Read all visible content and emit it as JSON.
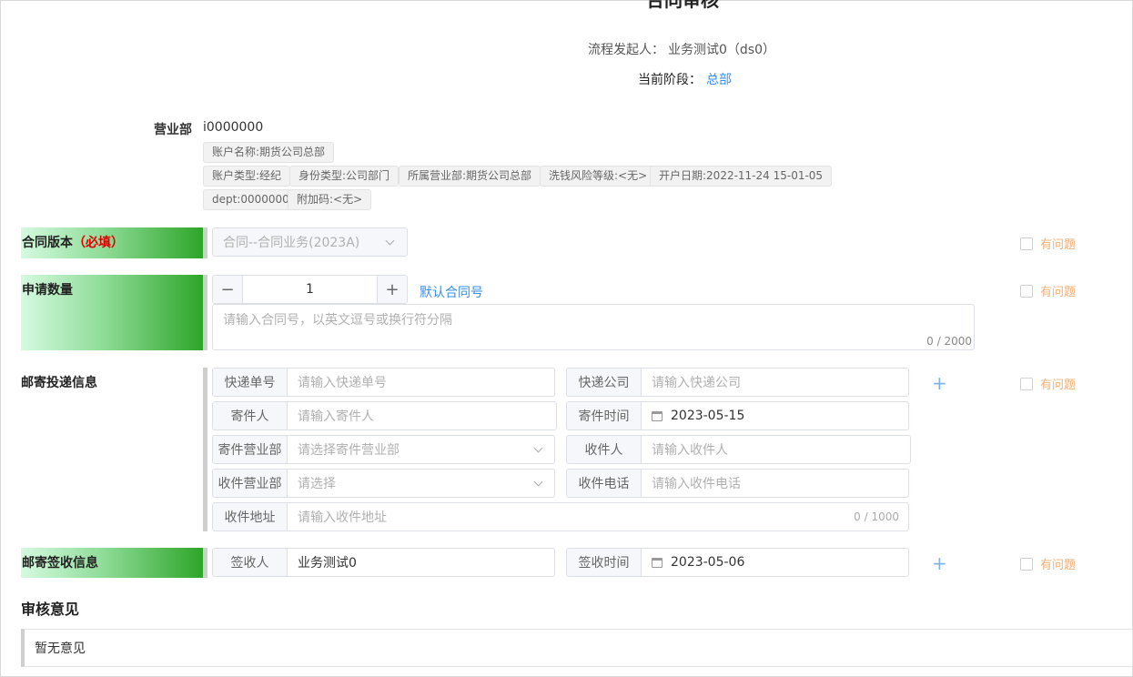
{
  "header": {
    "title": "合同审核",
    "initiator_label": "流程发起人：",
    "initiator_value": "业务测试0（ds0）",
    "stage_label": "当前阶段：",
    "stage_value": "总部"
  },
  "branch": {
    "label": "营业部",
    "value": "i0000000",
    "tags": [
      "账户名称:期货公司总部",
      "账户类型:经纪",
      "身份类型:公司部门",
      "所属营业部:期货公司总部",
      "洗钱风险等级:<无>",
      "开户日期:2022-11-24 15-01-05",
      "dept:0000000",
      "附加码:<无>"
    ]
  },
  "contract_version": {
    "label": "合同版本",
    "required": "（必填）",
    "value": "合同--合同业务(2023A)"
  },
  "apply_quantity": {
    "label": "申请数量",
    "minus": "−",
    "value": "1",
    "plus": "+",
    "default_link": "默认合同号",
    "textarea_placeholder": "请输入合同号，以英文逗号或换行符分隔",
    "textarea_count": "0 / 2000"
  },
  "mail_info": {
    "label": "邮寄投递信息",
    "fields": {
      "tracking_no": {
        "label": "快递单号",
        "placeholder": "请输入快递单号"
      },
      "courier": {
        "label": "快递公司",
        "placeholder": "请输入快递公司"
      },
      "sender": {
        "label": "寄件人",
        "placeholder": "请输入寄件人"
      },
      "send_time": {
        "label": "寄件时间",
        "value": "2023-05-15"
      },
      "sender_branch": {
        "label": "寄件营业部",
        "placeholder": "请选择寄件营业部"
      },
      "receiver": {
        "label": "收件人",
        "placeholder": "请输入收件人"
      },
      "receiver_branch": {
        "label": "收件营业部",
        "placeholder": "请选择"
      },
      "receiver_phone": {
        "label": "收件电话",
        "placeholder": "请输入收件电话"
      },
      "receiver_address": {
        "label": "收件地址",
        "placeholder": "请输入收件地址",
        "count": "0 / 1000"
      }
    },
    "add": "+"
  },
  "sign_info": {
    "label": "邮寄签收信息",
    "signer": {
      "label": "签收人",
      "value": "业务测试0"
    },
    "sign_time": {
      "label": "签收时间",
      "value": "2023-05-06"
    },
    "add": "+"
  },
  "issue_label": "有问题",
  "review": {
    "title": "审核意见",
    "content": "暂无意见"
  },
  "colors": {
    "link": "#3a8ee6",
    "required": "#e00000",
    "issue": "#f0b078",
    "gradient_end": "#2ea52a"
  }
}
